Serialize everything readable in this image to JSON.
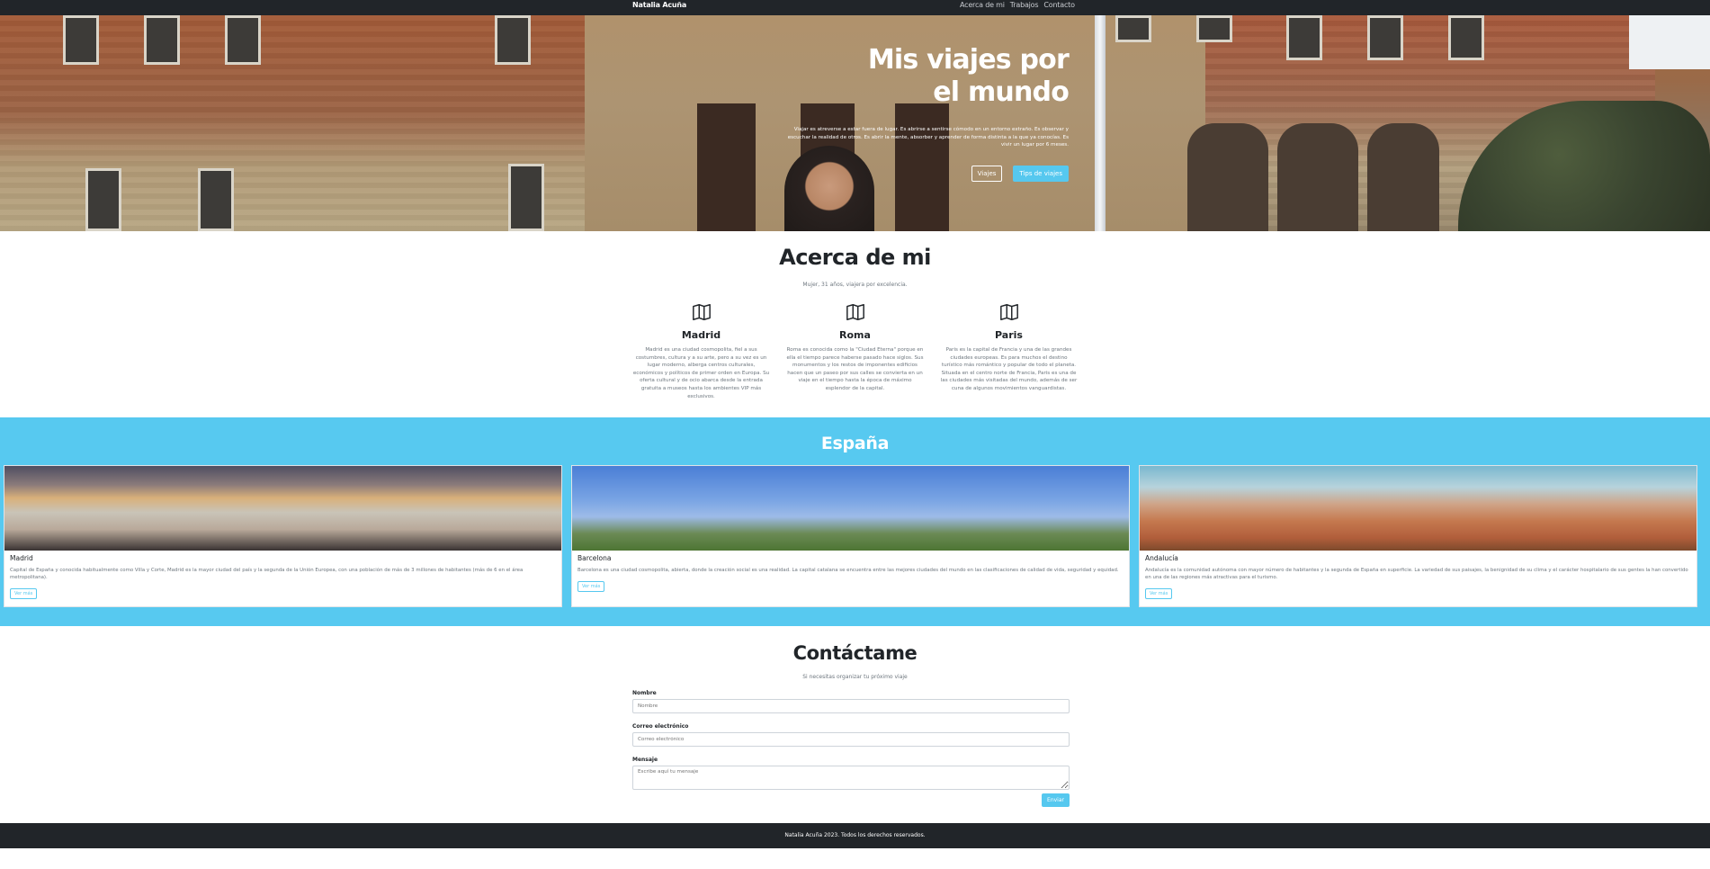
{
  "navbar": {
    "brand": "Natalia Acuña",
    "links": [
      "Acerca de mi",
      "Trabajos",
      "Contacto"
    ]
  },
  "hero": {
    "title": "Mis viajes por el mundo",
    "description": "Viajar es atreverse a estar fuera de lugar. Es abrirse a sentirse cómodo en un entorno extraño. Es observar y escuchar la realidad de otros. Es abrir la mente, absorber y aprender de forma distinta a la que ya conocías. Es vivir un lugar por 6 meses.",
    "buttons": [
      "Viajes",
      "Tips de viajes"
    ]
  },
  "about": {
    "title": "Acerca de mi",
    "subtitle": "Mujer, 31 años, viajera por excelencia.",
    "features": [
      {
        "icon": "map-icon",
        "title": "Madrid",
        "text": "Madrid es una ciudad cosmopolita, fiel a sus costumbres, cultura y a su arte, pero a su vez es un lugar moderno, alberga centros culturales, económicos y políticos de primer orden en Europa. Su oferta cultural y de ocio abarca desde la entrada gratuita a museos hasta los ambientes VIP más exclusivos."
      },
      {
        "icon": "map-icon",
        "title": "Roma",
        "text": "Roma es conocida como la \"Ciudad Eterna\" porque en ella el tiempo parece haberse pasado hace siglos. Sus monumentos y los restos de imponentes edificios hacen que un paseo por sus calles se convierta en un viaje en el tiempo hasta la época de máximo esplendor de la capital."
      },
      {
        "icon": "map-icon",
        "title": "Paris",
        "text": "Paris es la capital de Francia y una de las grandes ciudades europeas. Es para muchos el destino turístico más romántico y popular de todo el planeta. Situada en el centro norte de Francia, Paris es una de las ciudades más visitadas del mundo, además de ser cuna de algunos movimientos vanguardistas."
      }
    ]
  },
  "spain": {
    "title": "España",
    "cards": [
      {
        "title": "Madrid",
        "text": "Capital de España y conocida habitualmente como Villa y Corte, Madrid es la mayor ciudad del país y la segunda de la Unión Europea, con una población de más de 3 millones de habitantes (más de 6 en el área metropolitana).",
        "button": "Ver más"
      },
      {
        "title": "Barcelona",
        "text": "Barcelona es una ciudad cosmopolita, abierta, donde la creación social es una realidad. La capital catalana se encuentra entre las mejores ciudades del mundo en las clasificaciones de calidad de vida, seguridad y equidad.",
        "button": "Ver más"
      },
      {
        "title": "Andalucía",
        "text": "Andalucía es la comunidad autónoma con mayor número de habitantes y la segunda de España en superficie. La variedad de sus paisajes, la benignidad de su clima y el carácter hospitalario de sus gentes la han convertido en una de las regiones más atractivas para el turismo.",
        "button": "Ver más"
      }
    ]
  },
  "contact": {
    "title": "Contáctame",
    "subtitle": "Si necesitas organizar tu próximo viaje",
    "name_label": "Nombre",
    "name_placeholder": "Nombre",
    "email_label": "Correo electrónico",
    "email_placeholder": "Correo electrónico",
    "message_label": "Mensaje",
    "message_placeholder": "Escribe aquí tu mensaje",
    "submit_label": "Enviar"
  },
  "footer": {
    "text": "Natalia Acuña 2023. Todos los derechos reservados."
  },
  "colors": {
    "navbar": "#212529",
    "accent": "#56c8ef",
    "spain_bg": "#57c9f0"
  }
}
